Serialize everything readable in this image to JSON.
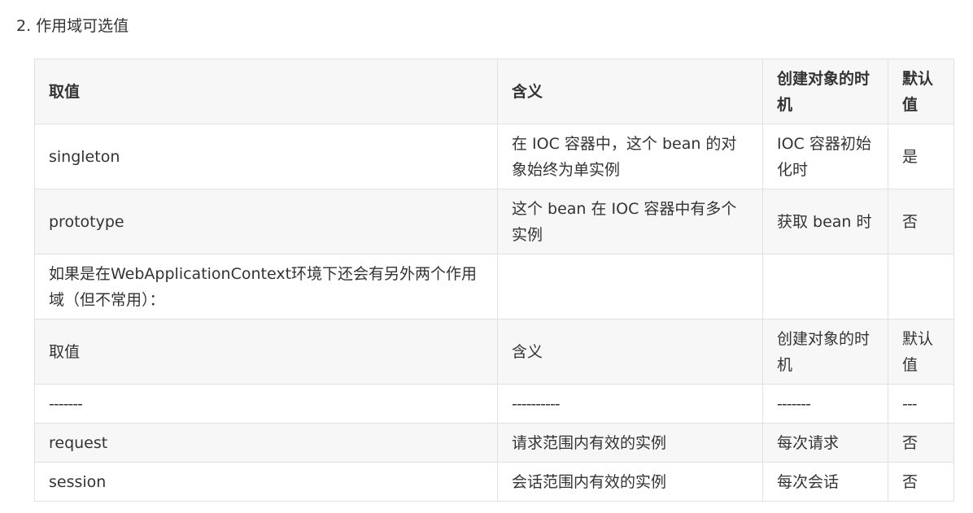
{
  "heading": {
    "number": "2.",
    "text": "作用域可选值"
  },
  "table": {
    "columns": [
      "取值",
      "含义",
      "创建对象的时机",
      "默认值"
    ],
    "rows": [
      [
        "singleton",
        "在 IOC 容器中，这个 bean 的对象始终为单实例",
        "IOC 容器初始化时",
        "是"
      ],
      [
        "prototype",
        "这个 bean 在 IOC 容器中有多个实例",
        "获取 bean 时",
        "否"
      ],
      [
        "如果是在WebApplicationContext环境下还会有另外两个作用域（但不常用）：",
        "",
        "",
        ""
      ],
      [
        "取值",
        "含义",
        "创建对象的时机",
        "默认值"
      ],
      [
        "-------",
        "----------",
        "-------",
        "---"
      ],
      [
        "request",
        "请求范围内有效的实例",
        "每次请求",
        "否"
      ],
      [
        "session",
        "会话范围内有效的实例",
        "每次会话",
        "否"
      ]
    ]
  }
}
